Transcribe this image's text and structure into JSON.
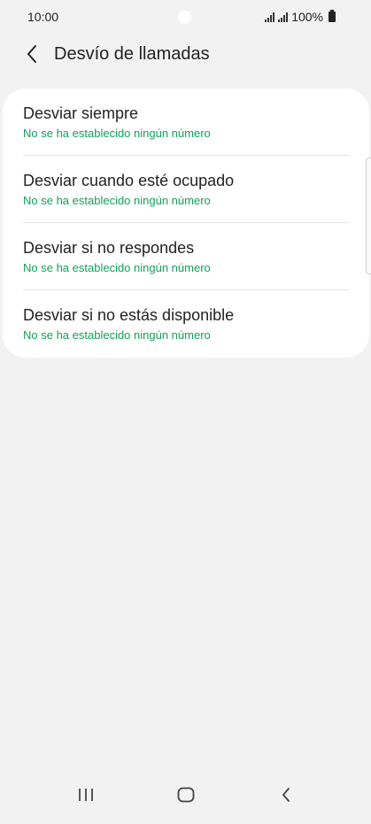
{
  "status_bar": {
    "time": "10:00",
    "battery_text": "100%",
    "icons": [
      "signal-icon",
      "signal-icon",
      "battery-icon"
    ]
  },
  "header": {
    "title": "Desvío de llamadas",
    "back_icon": "chevron-left-icon"
  },
  "forwarding_options": [
    {
      "label": "Desviar siempre",
      "status": "No se ha establecido ningún número"
    },
    {
      "label": "Desviar cuando esté ocupado",
      "status": "No se ha establecido ningún número"
    },
    {
      "label": "Desviar si no respondes",
      "status": "No se ha establecido ningún número"
    },
    {
      "label": "Desviar si no estás disponible",
      "status": "No se ha establecido ningún número"
    }
  ],
  "nav_bar": {
    "icons": [
      "recent-apps-icon",
      "home-icon",
      "back-icon"
    ]
  },
  "colors": {
    "background": "#f2f2f2",
    "card": "#ffffff",
    "status_text": "#12a05a"
  }
}
